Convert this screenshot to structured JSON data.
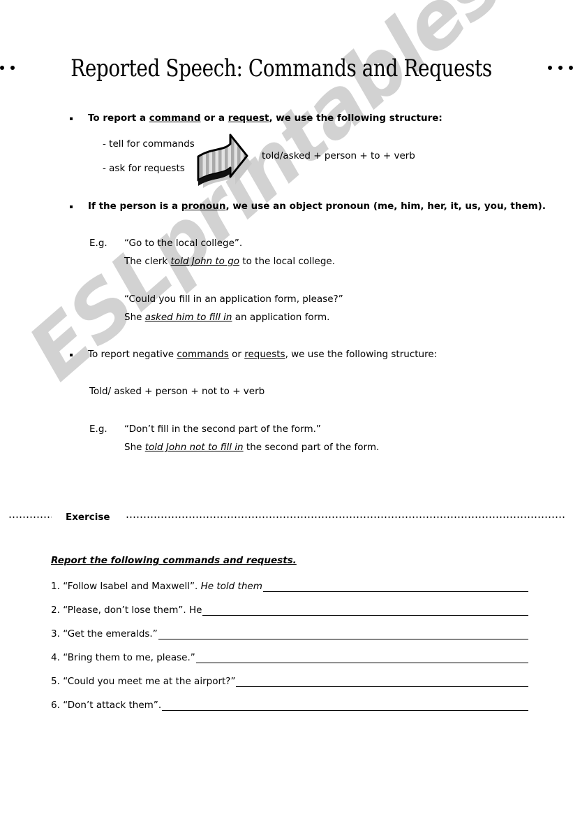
{
  "document": {
    "title": "Reported Speech: Commands and Requests",
    "watermark": "ESLprintables.com",
    "watermark_color": "#d2d2d2"
  },
  "lesson": {
    "bullet1": {
      "marker": "square-bullet",
      "prefix": "To report a ",
      "term1": "command",
      "mid": " or a ",
      "term2": "request",
      "suffix": ", we use the following structure:",
      "sub_items": [
        "- tell for commands",
        "- ask for requests"
      ],
      "formula": "told/asked + person + to + verb",
      "graphic": "striped-arrow-right-icon"
    },
    "bullet2": {
      "marker": "square-bullet",
      "prefix": "If the person is a ",
      "term1": "pronoun",
      "suffix": ", we use an object pronoun (me, him, her, it, us, you, them).",
      "eg_label": "E.g.",
      "examples": [
        {
          "quote": "“Go to the local college”.",
          "answer_pre": "The clerk ",
          "answer_em": "told John to go",
          "answer_post": " to the local college."
        },
        {
          "quote": "“Could you fill in an application form, please?”",
          "answer_pre": "She ",
          "answer_em": "asked him to fill in",
          "answer_post": " an application form."
        }
      ]
    },
    "bullet3": {
      "marker": "square-bullet",
      "prefix": "To report negative ",
      "term1": "commands",
      "mid": " or ",
      "term2": "requests",
      "suffix": ", we use the following structure:",
      "formula": "Told/ asked + person + not to + verb",
      "eg_label": "E.g.",
      "examples": [
        {
          "quote": "“Don’t fill in the second part of the form.”",
          "answer_pre": "She ",
          "answer_em": "told John not to fill in",
          "answer_post": " the second part of the form."
        }
      ]
    }
  },
  "exercise": {
    "section_label": "Exercise",
    "instruction": "Report the following commands and requests.",
    "items": [
      {
        "number": "1.",
        "quote": "“Follow Isabel and Maxwell”.",
        "lead_in": " He told them",
        "lead_in_italic": true,
        "answer": ""
      },
      {
        "number": "2.",
        "quote": "“Please, don’t lose them”.",
        "lead_in": " He ",
        "lead_in_italic": false,
        "answer": ""
      },
      {
        "number": "3.",
        "quote": "“Get the emeralds.”",
        "lead_in": "",
        "lead_in_italic": false,
        "answer": ""
      },
      {
        "number": "4.",
        "quote": "“Bring them to me, please.”",
        "lead_in": " ",
        "lead_in_italic": false,
        "answer": ""
      },
      {
        "number": "5.",
        "quote": "“Could you meet me at the airport?”",
        "lead_in": " ",
        "lead_in_italic": false,
        "answer": ""
      },
      {
        "number": "6.",
        "quote": "“Don’t attack them”.",
        "lead_in": " ",
        "lead_in_italic": false,
        "answer": ""
      }
    ]
  }
}
